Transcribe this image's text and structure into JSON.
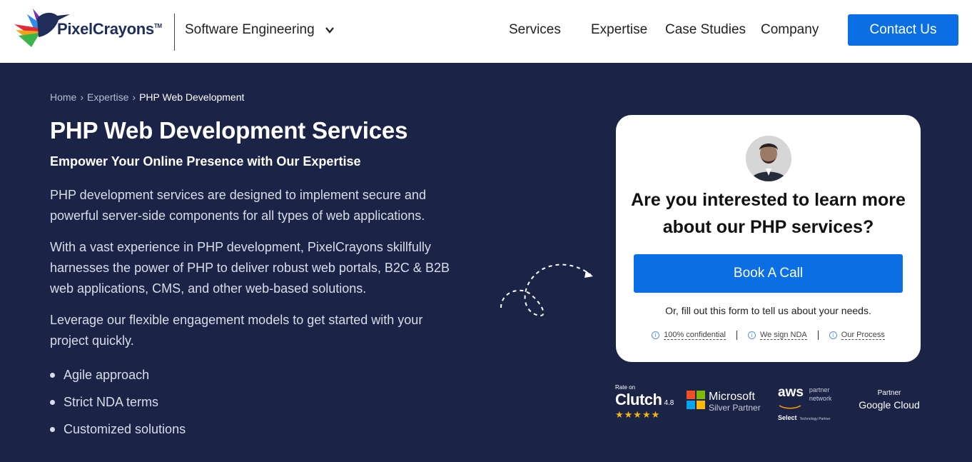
{
  "header": {
    "brand": "PixelCrayons",
    "brand_tm": "TM",
    "division": "Software Engineering",
    "nav": [
      "Services",
      "Expertise",
      "Case Studies",
      "Company"
    ],
    "contact_label": "Contact Us"
  },
  "hero": {
    "breadcrumb": [
      "Home",
      "Expertise",
      "PHP Web Development"
    ],
    "title": "PHP Web Development Services",
    "subtitle": "Empower Your Online Presence with Our Expertise",
    "paragraphs": [
      "PHP development services are designed to implement secure and powerful server-side components for all types of web applications.",
      "With a vast experience in PHP development, PixelCrayons skillfully harnesses the power of PHP to deliver robust web portals, B2C & B2B web applications, CMS, and other web-based solutions.",
      "Leverage our flexible engagement models to get started with your project quickly."
    ],
    "bullets": [
      "Agile approach",
      "Strict NDA terms",
      "Customized solutions"
    ]
  },
  "card": {
    "question": "Are you interested to learn more about our PHP services?",
    "book_label": "Book A Call",
    "fill_text": "Or, fill out this form to tell us about your needs.",
    "badges": [
      "100% confidential",
      "We sign NDA",
      "Our Process"
    ]
  },
  "partners": {
    "clutch": {
      "rate_on": "Rate on",
      "name": "Clutch",
      "score": "4.8",
      "stars": 5
    },
    "microsoft": {
      "name": "Microsoft",
      "tier": "Silver Partner"
    },
    "aws": {
      "name": "aws",
      "line1": "partner",
      "line2": "network",
      "tier": "Select",
      "tier_sub": "Technology Partner"
    },
    "google": {
      "label": "Partner",
      "name": "Google Cloud"
    }
  },
  "colors": {
    "hero_bg": "#1b2447",
    "accent": "#0a6ee4",
    "header_bg": "#ffffff",
    "card_bg": "#ffffff"
  }
}
